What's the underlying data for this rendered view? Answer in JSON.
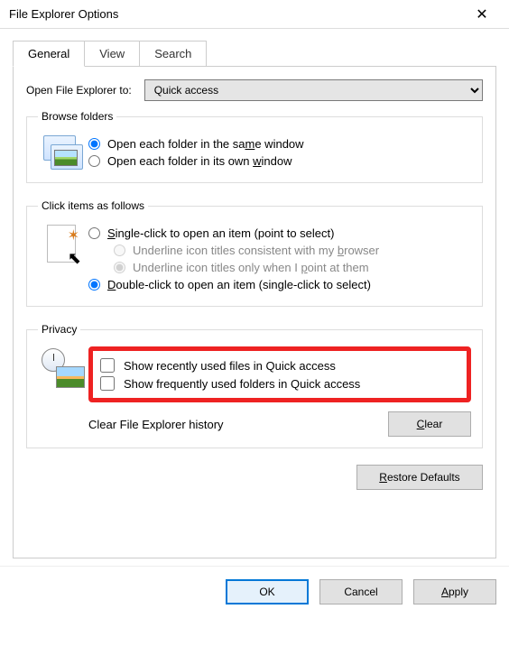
{
  "titlebar": {
    "title": "File Explorer Options"
  },
  "tabs": {
    "general": "General",
    "view": "View",
    "search": "Search"
  },
  "open_to": {
    "label": "Open File Explorer to:",
    "value": "Quick access"
  },
  "browse": {
    "legend": "Browse folders",
    "same_window": "Open each folder in the same window",
    "own_window": "Open each folder in its own window"
  },
  "click_items": {
    "legend": "Click items as follows",
    "single_click": "Single-click to open an item (point to select)",
    "underline_browser": "Underline icon titles consistent with my browser",
    "underline_point": "Underline icon titles only when I point at them",
    "double_click": "Double-click to open an item (single-click to select)"
  },
  "privacy": {
    "legend": "Privacy",
    "show_recent_files": "Show recently used files in Quick access",
    "show_frequent_folders": "Show frequently used folders in Quick access",
    "clear_label": "Clear File Explorer history",
    "clear_button": "Clear"
  },
  "restore_defaults": "Restore Defaults",
  "footer": {
    "ok": "OK",
    "cancel": "Cancel",
    "apply": "Apply"
  }
}
